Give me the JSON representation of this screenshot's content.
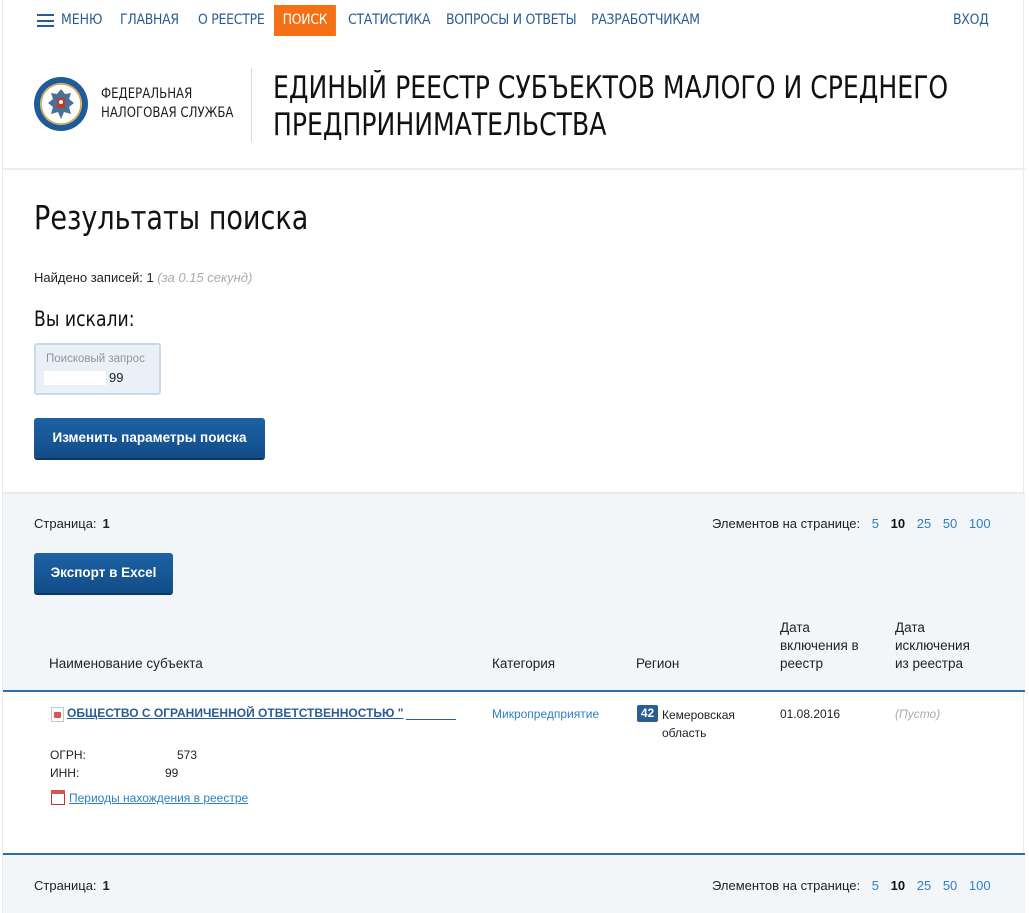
{
  "nav": {
    "menu": "Меню",
    "items": [
      "Главная",
      "О реестре",
      "Поиск",
      "Статистика",
      "Вопросы и ответы",
      "Разработчикам"
    ],
    "login": "Вход",
    "active_color": "#f57014",
    "link_color": "#2a5d94"
  },
  "header": {
    "agency_line1": "Федеральная",
    "agency_line2": "налоговая служба",
    "title_line1": "Единый реестр субъектов малого и среднего",
    "title_line2": "предпринимательства"
  },
  "results": {
    "title": "Результаты поиска",
    "found_label": "Найдено записей:",
    "found_count": "1",
    "found_time": "(за 0.15 секунд)",
    "you_searched": "Вы искали:",
    "query_label": "Поисковый запрос",
    "query_value": "99",
    "change_params_button": "Изменить параметры поиска"
  },
  "pager": {
    "page_label": "Страница:",
    "page_number": "1",
    "per_page_label": "Элементов на странице:",
    "per_page_options": [
      "5",
      "10",
      "25",
      "50",
      "100"
    ],
    "per_page_selected": "10"
  },
  "export_button": "Экспорт в Excel",
  "table": {
    "headers": {
      "name": "Наименование субъекта",
      "category": "Категория",
      "region": "Регион",
      "date_in_1": "Дата",
      "date_in_2": "включения в",
      "date_in_3": "реестр",
      "date_out_1": "Дата",
      "date_out_2": "исключения",
      "date_out_3": "из реестра"
    },
    "rows": [
      {
        "name": "ОБЩЕСТВО С ОГРАНИЧЕННОЙ ОТВЕТСТВЕННОСТЬЮ \"",
        "category": "Микропредприятие",
        "region_code": "42",
        "region_name": "Кемеровская область",
        "date_in": "01.08.2016",
        "date_out": "(Пусто)",
        "ogrn_label": "ОГРН:",
        "ogrn_value": "573",
        "inn_label": "ИНН:",
        "inn_value": "99",
        "periods_link": "Периоды нахождения в реестре"
      }
    ]
  }
}
